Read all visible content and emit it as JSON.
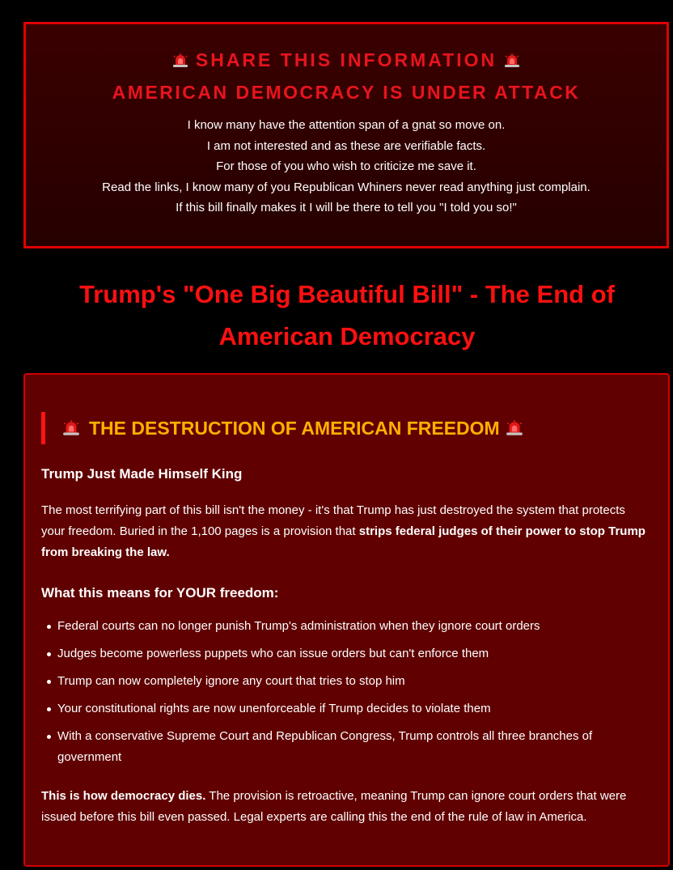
{
  "alert": {
    "title": "SHARE THIS INFORMATION",
    "subtitle": "AMERICAN DEMOCRACY IS UNDER ATTACK",
    "lines": [
      "I know many have the attention span of a gnat so move on.",
      "I am not interested and as these are verifiable facts.",
      "For those of you who wish to criticize me save it.",
      "Read the links, I know many of you Republican Whiners never read anything just complain.",
      "If this bill finally makes it I will be there to tell you \"I told you so!\""
    ],
    "icon": "siren-icon"
  },
  "headline": {
    "line1": "Trump's \"One Big Beautiful Bill\" - The End of",
    "line2": "American Democracy"
  },
  "section": {
    "heading": "THE DESTRUCTION OF AMERICAN FREEDOM",
    "subheading": "Trump Just Made Himself King",
    "paragraph_lead": "The most terrifying part of this bill isn't the money - it's that Trump has just destroyed the system that protects your freedom. Buried in the 1,100 pages is a provision that ",
    "paragraph_bold": "strips federal judges of their power to stop Trump from breaking the law.",
    "list_heading": "What this means for YOUR freedom:",
    "bullets": [
      "Federal courts can no longer punish Trump's administration when they ignore court orders",
      "Judges become powerless puppets who can issue orders but can't enforce them",
      "Trump can now completely ignore any court that tries to stop him",
      "Your constitutional rights are now unenforceable if Trump decides to violate them",
      "With a conservative Supreme Court and Republican Congress, Trump controls all three branches of government"
    ],
    "closing_bold": "This is how democracy dies.",
    "closing_rest": " The provision is retroactive, meaning Trump can ignore court orders that were issued before this bill even passed. Legal experts are calling this the end of the rule of law in America."
  },
  "colors": {
    "background": "#000000",
    "alert_red": "#e8141e",
    "headline_red": "#ff1010",
    "section_bg": "#600000",
    "section_heading": "#ffb000",
    "border_red": "#e00000"
  }
}
